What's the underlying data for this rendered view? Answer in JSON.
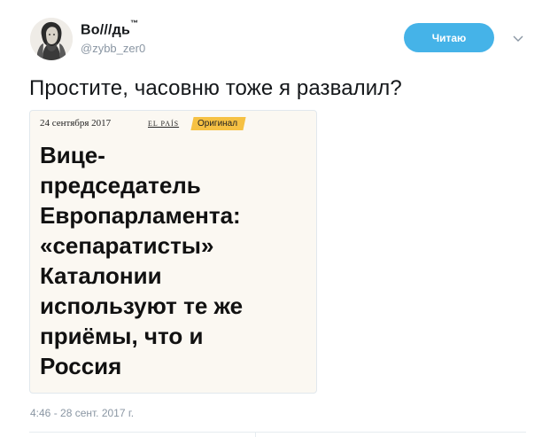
{
  "header": {
    "display_name": "Во///дь",
    "trademark": "™",
    "username": "@zybb_zer0",
    "follow_label": "Читаю"
  },
  "tweet": {
    "text": "Простите, часовню тоже я развалил?",
    "timestamp": "4:46 - 28 сент. 2017 г."
  },
  "card": {
    "date": "24 сентября 2017",
    "source": "EL PAÍS",
    "badge": "Оригинал",
    "headline_lines": [
      "Вице-",
      "председатель",
      "Европарламента:",
      "«сепаратисты»",
      "Каталонии",
      "используют те же",
      "приёмы, что и",
      "Россия"
    ]
  },
  "colors": {
    "follow_button": "#45b3e8",
    "badge": "#f6c143",
    "muted_text": "#8a96a3"
  }
}
